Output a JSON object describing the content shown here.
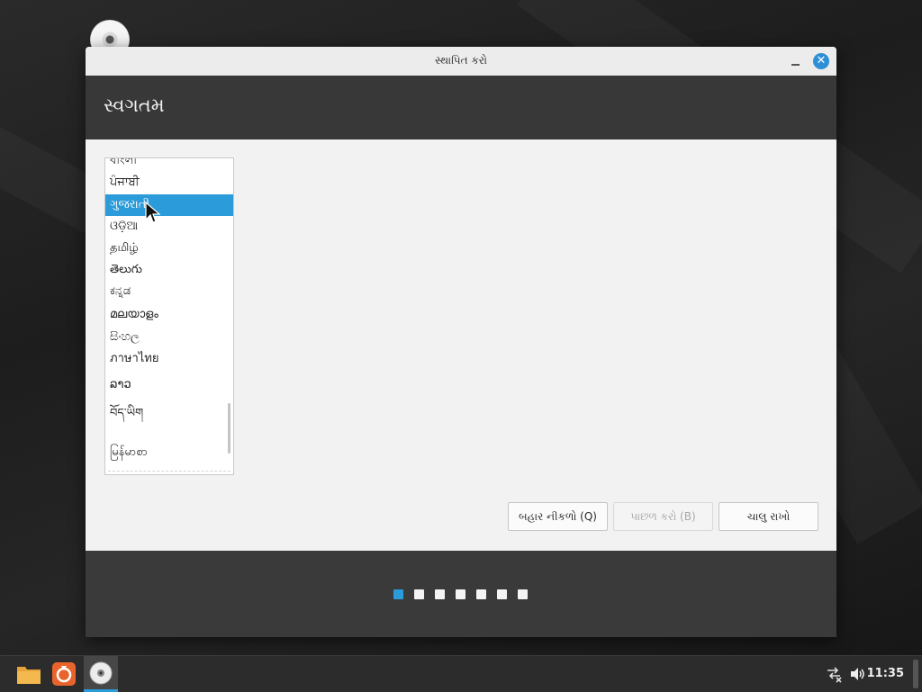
{
  "window": {
    "title": "સ્થાપિત કરો",
    "close_glyph": "✕"
  },
  "header": {
    "title": "સ્વગતમ"
  },
  "language_list": {
    "items": [
      {
        "label": "বাংলা",
        "selected": false
      },
      {
        "label": "ਪੰਜਾਬੀ",
        "selected": false
      },
      {
        "label": "ગુજરાતી",
        "selected": true
      },
      {
        "label": "ଓଡ଼ିଆ",
        "selected": false
      },
      {
        "label": "தமிழ்",
        "selected": false
      },
      {
        "label": "తెలుగు",
        "selected": false
      },
      {
        "label": "ಕನ್ನಡ",
        "selected": false
      },
      {
        "label": "മലയാളം",
        "selected": false
      },
      {
        "label": "සිංහල",
        "selected": false
      },
      {
        "label": "ภาษาไทย",
        "selected": false
      },
      {
        "label": "ລາວ",
        "selected": false
      },
      {
        "label": "བོད་ཡིག",
        "selected": false
      },
      {
        "label": "မြန်မာစာ",
        "selected": false
      }
    ]
  },
  "buttons": {
    "quit_label": "બહાર નીકળો (Q)",
    "back_label": "પાછળ કરો (B)",
    "continue_label": "ચાલુ રાખો"
  },
  "progress": {
    "total_steps": 7,
    "current_step": 1
  },
  "taskbar": {
    "clock": "11:35",
    "apps": [
      "folder-icon",
      "installer-app-icon",
      "disc-icon"
    ]
  },
  "colors": {
    "accent": "#2b9bd9",
    "header_bg": "#383838"
  }
}
